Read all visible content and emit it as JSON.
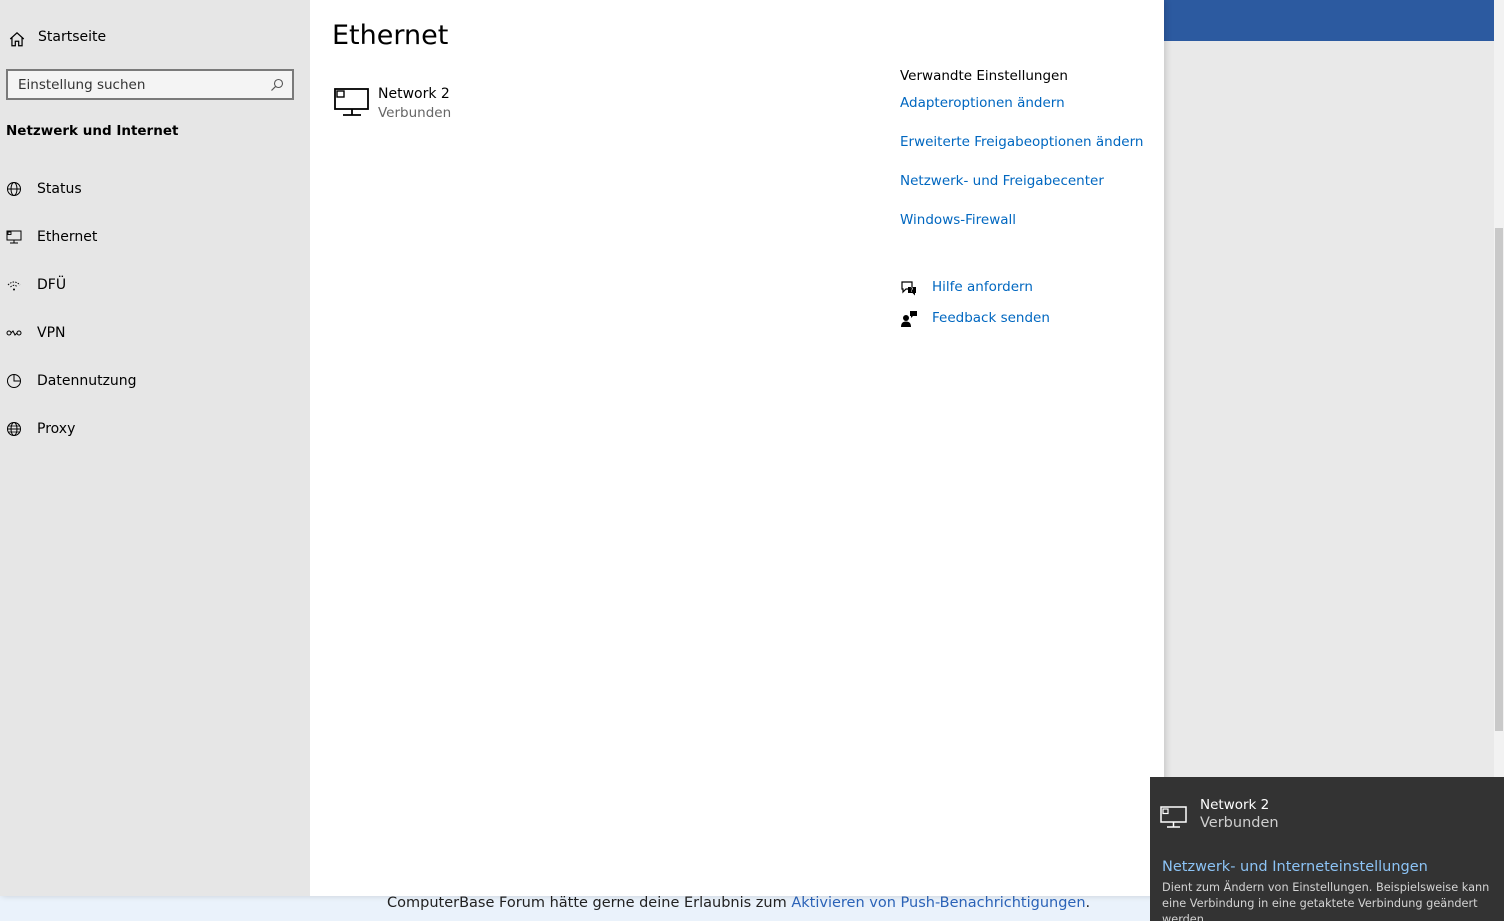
{
  "sidebar": {
    "home_label": "Startseite",
    "search_placeholder": "Einstellung suchen",
    "section_title": "Netzwerk und Internet",
    "items": [
      {
        "label": "Status",
        "icon": "globe-status-icon"
      },
      {
        "label": "Ethernet",
        "icon": "ethernet-icon"
      },
      {
        "label": "DFÜ",
        "icon": "dialup-icon"
      },
      {
        "label": "VPN",
        "icon": "vpn-icon"
      },
      {
        "label": "Datennutzung",
        "icon": "data-usage-icon"
      },
      {
        "label": "Proxy",
        "icon": "globe-icon"
      }
    ]
  },
  "main": {
    "title": "Ethernet",
    "network": {
      "name": "Network 2",
      "status": "Verbunden"
    },
    "related": {
      "title": "Verwandte Einstellungen",
      "links": [
        "Adapteroptionen ändern",
        "Erweiterte Freigabeoptionen ändern",
        "Netzwerk- und Freigabecenter",
        "Windows-Firewall"
      ]
    },
    "help": {
      "get_help": "Hilfe anfordern",
      "feedback": "Feedback senden"
    }
  },
  "flyout": {
    "network_name": "Network 2",
    "network_status": "Verbunden",
    "settings_link": "Netzwerk- und Interneteinstellungen",
    "description": "Dient zum Ändern von Einstellungen. Beispielsweise kann eine Verbindung in eine getaktete Verbindung geändert werden."
  },
  "background": {
    "push_text": "ComputerBase Forum hätte gerne deine Erlaubnis zum ",
    "push_link": "Aktivieren von Push-Benachrichtigungen",
    "push_end": "."
  },
  "colors": {
    "link": "#0067c0",
    "flyout_bg": "#333333",
    "flyout_link": "#8cc3f5",
    "sidebar_bg": "#e6e6e6",
    "bg_header": "#2c5aa0"
  }
}
